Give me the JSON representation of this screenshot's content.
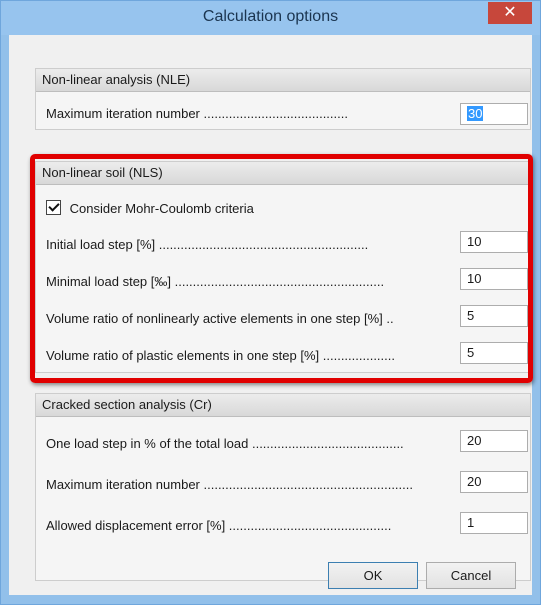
{
  "window": {
    "title": "Calculation options",
    "close_symbol": "✕"
  },
  "groups": {
    "nle": {
      "header": "Non-linear analysis (NLE)",
      "rows": [
        {
          "label": "Maximum iteration number ........................................",
          "value": "30"
        }
      ]
    },
    "nls": {
      "header": "Non-linear soil (NLS)",
      "checkbox": {
        "label": "Consider Mohr-Coulomb criteria",
        "checked": true
      },
      "rows": [
        {
          "label": "Initial load step [%] ..........................................................",
          "value": "10"
        },
        {
          "label": "Minimal load step [‰] ..........................................................",
          "value": "10"
        },
        {
          "label": "Volume ratio of nonlinearly active elements in one step [%] ..",
          "value": "5"
        },
        {
          "label": "Volume ratio of plastic elements in one step [%] ....................",
          "value": "5"
        }
      ]
    },
    "cr": {
      "header": "Cracked section analysis (Cr)",
      "rows": [
        {
          "label": "One load step in % of the total load ..........................................",
          "value": "20"
        },
        {
          "label": "Maximum iteration number ..........................................................",
          "value": "20"
        },
        {
          "label": "Allowed displacement error [%] .............................................",
          "value": "1"
        }
      ]
    }
  },
  "buttons": {
    "ok": "OK",
    "cancel": "Cancel"
  },
  "colors": {
    "highlight": "#e00000",
    "selection": "#3399ff",
    "titlebar": "#97c4ee",
    "close": "#c7473b"
  }
}
